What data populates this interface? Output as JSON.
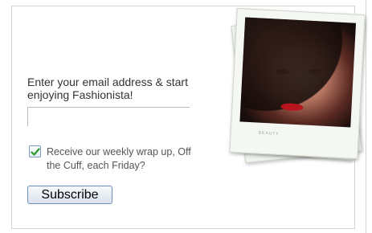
{
  "signup": {
    "prompt": "Enter your email address & start enjoying Fashionista!",
    "email_value": "",
    "checkbox_checked": true,
    "checkbox_label": "Receive our weekly wrap up, Off the Cuff, each Friday?",
    "subscribe_label": "Subscribe"
  },
  "photo": {
    "caption": "BEAUTY"
  },
  "colors": {
    "frame_border": "#d4d4d4",
    "button_border": "#6f8fb8",
    "check_green": "#2a9a2a"
  }
}
